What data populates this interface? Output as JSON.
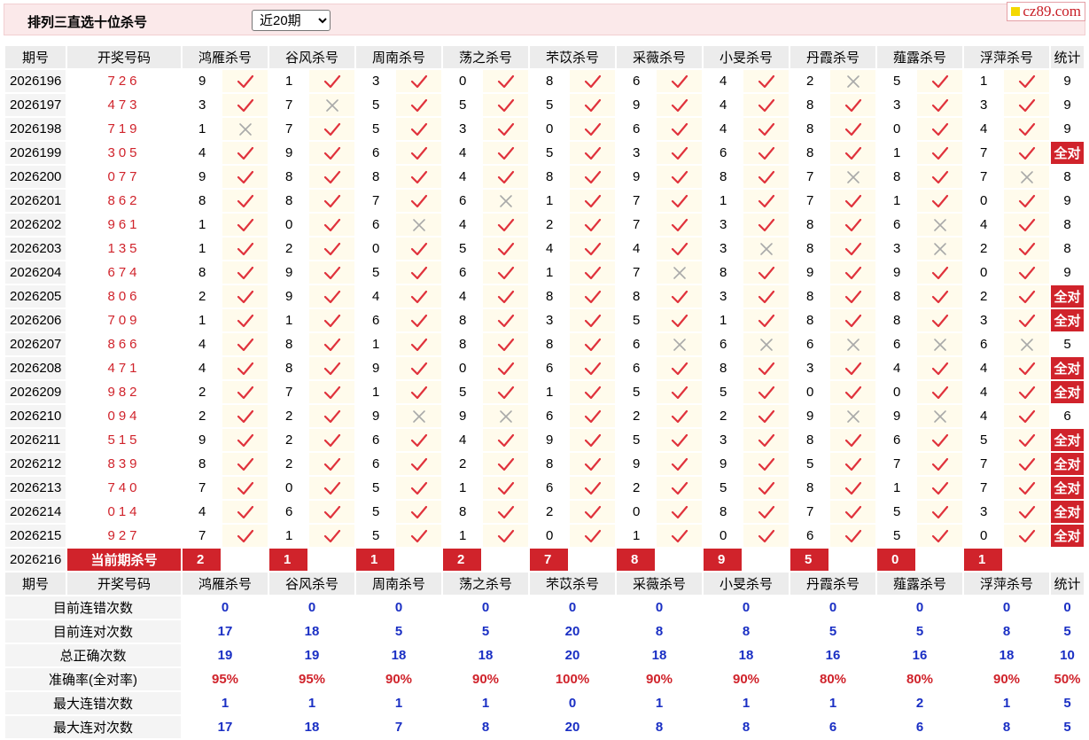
{
  "header": {
    "title": "排列三直选十位杀号",
    "range_selected": "近20期",
    "logo": "cz89.com"
  },
  "columns": {
    "period": "期号",
    "number": "开奖号码",
    "experts": [
      "鸿雁杀号",
      "谷风杀号",
      "周南杀号",
      "荡之杀号",
      "芣苡杀号",
      "采薇杀号",
      "小旻杀号",
      "丹霞杀号",
      "薤露杀号",
      "浮萍杀号"
    ],
    "stat": "统计"
  },
  "all_correct_label": "全对",
  "rows": [
    {
      "period": "2026196",
      "win": "726",
      "kills": [
        [
          9,
          1
        ],
        [
          1,
          1
        ],
        [
          3,
          1
        ],
        [
          0,
          1
        ],
        [
          8,
          1
        ],
        [
          6,
          1
        ],
        [
          4,
          1
        ],
        [
          2,
          0
        ],
        [
          5,
          1
        ],
        [
          1,
          1
        ]
      ],
      "stat": "9"
    },
    {
      "period": "2026197",
      "win": "473",
      "kills": [
        [
          3,
          1
        ],
        [
          7,
          0
        ],
        [
          5,
          1
        ],
        [
          5,
          1
        ],
        [
          5,
          1
        ],
        [
          9,
          1
        ],
        [
          4,
          1
        ],
        [
          8,
          1
        ],
        [
          3,
          1
        ],
        [
          3,
          1
        ]
      ],
      "stat": "9"
    },
    {
      "period": "2026198",
      "win": "719",
      "kills": [
        [
          1,
          0
        ],
        [
          7,
          1
        ],
        [
          5,
          1
        ],
        [
          3,
          1
        ],
        [
          0,
          1
        ],
        [
          6,
          1
        ],
        [
          4,
          1
        ],
        [
          8,
          1
        ],
        [
          0,
          1
        ],
        [
          4,
          1
        ]
      ],
      "stat": "9"
    },
    {
      "period": "2026199",
      "win": "305",
      "kills": [
        [
          4,
          1
        ],
        [
          9,
          1
        ],
        [
          6,
          1
        ],
        [
          4,
          1
        ],
        [
          5,
          1
        ],
        [
          3,
          1
        ],
        [
          6,
          1
        ],
        [
          8,
          1
        ],
        [
          1,
          1
        ],
        [
          7,
          1
        ]
      ],
      "stat": "全对"
    },
    {
      "period": "2026200",
      "win": "077",
      "kills": [
        [
          9,
          1
        ],
        [
          8,
          1
        ],
        [
          8,
          1
        ],
        [
          4,
          1
        ],
        [
          8,
          1
        ],
        [
          9,
          1
        ],
        [
          8,
          1
        ],
        [
          7,
          0
        ],
        [
          8,
          1
        ],
        [
          7,
          0
        ]
      ],
      "stat": "8"
    },
    {
      "period": "2026201",
      "win": "862",
      "kills": [
        [
          8,
          1
        ],
        [
          8,
          1
        ],
        [
          7,
          1
        ],
        [
          6,
          0
        ],
        [
          1,
          1
        ],
        [
          7,
          1
        ],
        [
          1,
          1
        ],
        [
          7,
          1
        ],
        [
          1,
          1
        ],
        [
          0,
          1
        ]
      ],
      "stat": "9"
    },
    {
      "period": "2026202",
      "win": "961",
      "kills": [
        [
          1,
          1
        ],
        [
          0,
          1
        ],
        [
          6,
          0
        ],
        [
          4,
          1
        ],
        [
          2,
          1
        ],
        [
          7,
          1
        ],
        [
          3,
          1
        ],
        [
          8,
          1
        ],
        [
          6,
          0
        ],
        [
          4,
          1
        ]
      ],
      "stat": "8"
    },
    {
      "period": "2026203",
      "win": "135",
      "kills": [
        [
          1,
          1
        ],
        [
          2,
          1
        ],
        [
          0,
          1
        ],
        [
          5,
          1
        ],
        [
          4,
          1
        ],
        [
          4,
          1
        ],
        [
          3,
          0
        ],
        [
          8,
          1
        ],
        [
          3,
          0
        ],
        [
          2,
          1
        ]
      ],
      "stat": "8"
    },
    {
      "period": "2026204",
      "win": "674",
      "kills": [
        [
          8,
          1
        ],
        [
          9,
          1
        ],
        [
          5,
          1
        ],
        [
          6,
          1
        ],
        [
          1,
          1
        ],
        [
          7,
          0
        ],
        [
          8,
          1
        ],
        [
          9,
          1
        ],
        [
          9,
          1
        ],
        [
          0,
          1
        ]
      ],
      "stat": "9"
    },
    {
      "period": "2026205",
      "win": "806",
      "kills": [
        [
          2,
          1
        ],
        [
          9,
          1
        ],
        [
          4,
          1
        ],
        [
          4,
          1
        ],
        [
          8,
          1
        ],
        [
          8,
          1
        ],
        [
          3,
          1
        ],
        [
          8,
          1
        ],
        [
          8,
          1
        ],
        [
          2,
          1
        ]
      ],
      "stat": "全对"
    },
    {
      "period": "2026206",
      "win": "709",
      "kills": [
        [
          1,
          1
        ],
        [
          1,
          1
        ],
        [
          6,
          1
        ],
        [
          8,
          1
        ],
        [
          3,
          1
        ],
        [
          5,
          1
        ],
        [
          1,
          1
        ],
        [
          8,
          1
        ],
        [
          8,
          1
        ],
        [
          3,
          1
        ]
      ],
      "stat": "全对"
    },
    {
      "period": "2026207",
      "win": "866",
      "kills": [
        [
          4,
          1
        ],
        [
          8,
          1
        ],
        [
          1,
          1
        ],
        [
          8,
          1
        ],
        [
          8,
          1
        ],
        [
          6,
          0
        ],
        [
          6,
          0
        ],
        [
          6,
          0
        ],
        [
          6,
          0
        ],
        [
          6,
          0
        ]
      ],
      "stat": "5"
    },
    {
      "period": "2026208",
      "win": "471",
      "kills": [
        [
          4,
          1
        ],
        [
          8,
          1
        ],
        [
          9,
          1
        ],
        [
          0,
          1
        ],
        [
          6,
          1
        ],
        [
          6,
          1
        ],
        [
          8,
          1
        ],
        [
          3,
          1
        ],
        [
          4,
          1
        ],
        [
          4,
          1
        ]
      ],
      "stat": "全对"
    },
    {
      "period": "2026209",
      "win": "982",
      "kills": [
        [
          2,
          1
        ],
        [
          7,
          1
        ],
        [
          1,
          1
        ],
        [
          5,
          1
        ],
        [
          1,
          1
        ],
        [
          5,
          1
        ],
        [
          5,
          1
        ],
        [
          0,
          1
        ],
        [
          0,
          1
        ],
        [
          4,
          1
        ]
      ],
      "stat": "全对"
    },
    {
      "period": "2026210",
      "win": "094",
      "kills": [
        [
          2,
          1
        ],
        [
          2,
          1
        ],
        [
          9,
          0
        ],
        [
          9,
          0
        ],
        [
          6,
          1
        ],
        [
          2,
          1
        ],
        [
          2,
          1
        ],
        [
          9,
          0
        ],
        [
          9,
          0
        ],
        [
          4,
          1
        ]
      ],
      "stat": "6"
    },
    {
      "period": "2026211",
      "win": "515",
      "kills": [
        [
          9,
          1
        ],
        [
          2,
          1
        ],
        [
          6,
          1
        ],
        [
          4,
          1
        ],
        [
          9,
          1
        ],
        [
          5,
          1
        ],
        [
          3,
          1
        ],
        [
          8,
          1
        ],
        [
          6,
          1
        ],
        [
          5,
          1
        ]
      ],
      "stat": "全对"
    },
    {
      "period": "2026212",
      "win": "839",
      "kills": [
        [
          8,
          1
        ],
        [
          2,
          1
        ],
        [
          6,
          1
        ],
        [
          2,
          1
        ],
        [
          8,
          1
        ],
        [
          9,
          1
        ],
        [
          9,
          1
        ],
        [
          5,
          1
        ],
        [
          7,
          1
        ],
        [
          7,
          1
        ]
      ],
      "stat": "全对"
    },
    {
      "period": "2026213",
      "win": "740",
      "kills": [
        [
          7,
          1
        ],
        [
          0,
          1
        ],
        [
          5,
          1
        ],
        [
          1,
          1
        ],
        [
          6,
          1
        ],
        [
          2,
          1
        ],
        [
          5,
          1
        ],
        [
          8,
          1
        ],
        [
          1,
          1
        ],
        [
          7,
          1
        ]
      ],
      "stat": "全对"
    },
    {
      "period": "2026214",
      "win": "014",
      "kills": [
        [
          4,
          1
        ],
        [
          6,
          1
        ],
        [
          5,
          1
        ],
        [
          8,
          1
        ],
        [
          2,
          1
        ],
        [
          0,
          1
        ],
        [
          8,
          1
        ],
        [
          7,
          1
        ],
        [
          5,
          1
        ],
        [
          3,
          1
        ]
      ],
      "stat": "全对"
    },
    {
      "period": "2026215",
      "win": "927",
      "kills": [
        [
          7,
          1
        ],
        [
          1,
          1
        ],
        [
          5,
          1
        ],
        [
          1,
          1
        ],
        [
          0,
          1
        ],
        [
          1,
          1
        ],
        [
          0,
          1
        ],
        [
          6,
          1
        ],
        [
          5,
          1
        ],
        [
          0,
          1
        ]
      ],
      "stat": "全对"
    }
  ],
  "current": {
    "period": "2026216",
    "label": "当前期杀号",
    "kills": [
      2,
      1,
      1,
      2,
      7,
      8,
      9,
      5,
      0,
      1
    ]
  },
  "summary": [
    {
      "label": "目前连错次数",
      "values": [
        "0",
        "0",
        "0",
        "0",
        "0",
        "0",
        "0",
        "0",
        "0",
        "0",
        "0"
      ],
      "rate": false
    },
    {
      "label": "目前连对次数",
      "values": [
        "17",
        "18",
        "5",
        "5",
        "20",
        "8",
        "8",
        "5",
        "5",
        "8",
        "5"
      ],
      "rate": false
    },
    {
      "label": "总正确次数",
      "values": [
        "19",
        "19",
        "18",
        "18",
        "20",
        "18",
        "18",
        "16",
        "16",
        "18",
        "10"
      ],
      "rate": false
    },
    {
      "label": "准确率(全对率)",
      "values": [
        "95%",
        "95%",
        "90%",
        "90%",
        "100%",
        "90%",
        "90%",
        "80%",
        "80%",
        "90%",
        "50%"
      ],
      "rate": true
    },
    {
      "label": "最大连错次数",
      "values": [
        "1",
        "1",
        "1",
        "1",
        "0",
        "1",
        "1",
        "1",
        "2",
        "1",
        "5"
      ],
      "rate": false
    },
    {
      "label": "最大连对次数",
      "values": [
        "17",
        "18",
        "7",
        "8",
        "20",
        "8",
        "8",
        "6",
        "6",
        "8",
        "5"
      ],
      "rate": false
    }
  ],
  "colors": {
    "accent_red": "#d0232b",
    "stat_blue": "#1a2fc4",
    "mark_bg": "#fffbec",
    "header_bg": "#ececec",
    "topbar_bg": "#fbe9ea"
  }
}
